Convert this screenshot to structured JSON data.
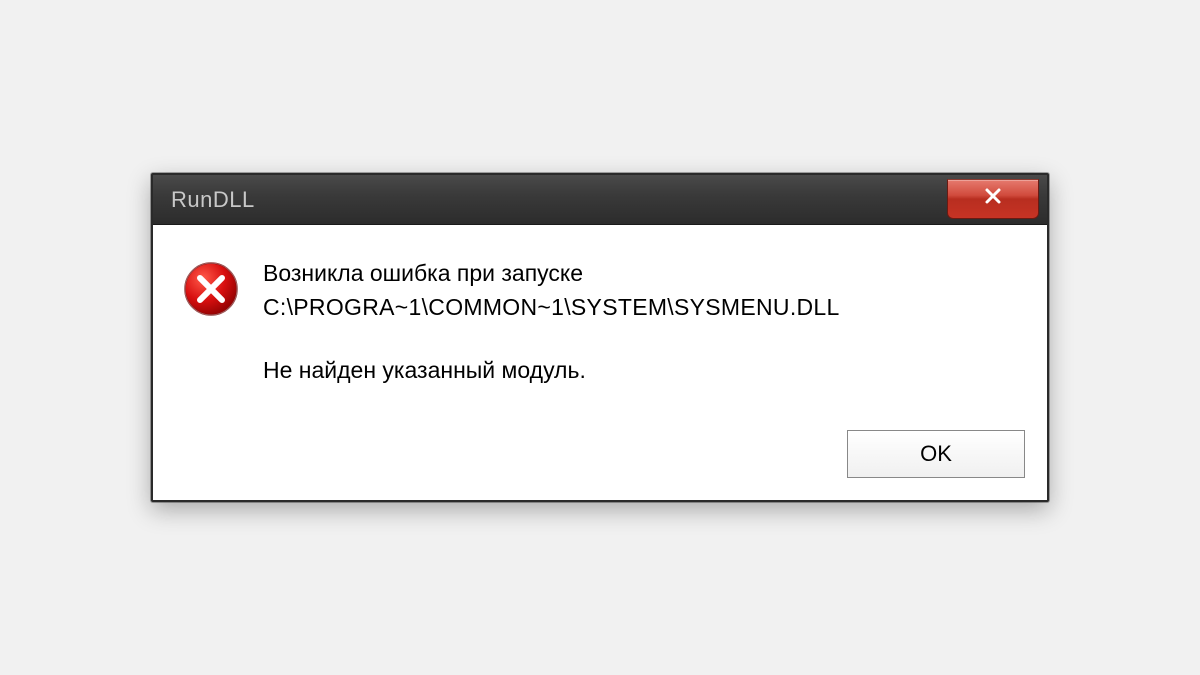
{
  "dialog": {
    "title": "RunDLL",
    "message_line1": "Возникла ошибка при запуске",
    "message_path": "C:\\PROGRA~1\\COMMON~1\\SYSTEM\\SYSMENU.DLL",
    "message_line3": "Не найден указанный модуль.",
    "ok_label": "OK"
  }
}
